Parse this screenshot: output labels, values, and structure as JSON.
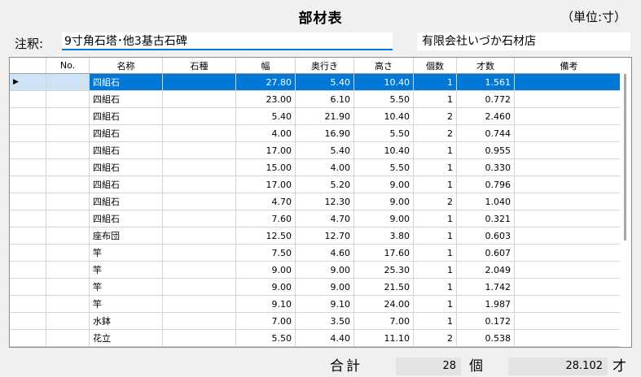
{
  "title": "部材表",
  "unit": "（単位:寸）",
  "note": {
    "label": "注釈:",
    "value": "9寸角石塔･他3基古石碑"
  },
  "company": "有限会社いづか石材店",
  "grid": {
    "columns": [
      "No.",
      "名称",
      "石種",
      "幅",
      "奥行き",
      "高さ",
      "個数",
      "才数",
      "備考"
    ],
    "selected_row": 0,
    "rows": [
      {
        "no": "",
        "name": "四組石",
        "stone": "",
        "width": "27.80",
        "depth": "5.40",
        "height": "10.40",
        "count": "1",
        "sai": "1.561",
        "note": ""
      },
      {
        "no": "",
        "name": "四組石",
        "stone": "",
        "width": "23.00",
        "depth": "6.10",
        "height": "5.50",
        "count": "1",
        "sai": "0.772",
        "note": ""
      },
      {
        "no": "",
        "name": "四組石",
        "stone": "",
        "width": "5.40",
        "depth": "21.90",
        "height": "10.40",
        "count": "2",
        "sai": "2.460",
        "note": ""
      },
      {
        "no": "",
        "name": "四組石",
        "stone": "",
        "width": "4.00",
        "depth": "16.90",
        "height": "5.50",
        "count": "2",
        "sai": "0.744",
        "note": ""
      },
      {
        "no": "",
        "name": "四組石",
        "stone": "",
        "width": "17.00",
        "depth": "5.40",
        "height": "10.40",
        "count": "1",
        "sai": "0.955",
        "note": ""
      },
      {
        "no": "",
        "name": "四組石",
        "stone": "",
        "width": "15.00",
        "depth": "4.00",
        "height": "5.50",
        "count": "1",
        "sai": "0.330",
        "note": ""
      },
      {
        "no": "",
        "name": "四組石",
        "stone": "",
        "width": "17.00",
        "depth": "5.20",
        "height": "9.00",
        "count": "1",
        "sai": "0.796",
        "note": ""
      },
      {
        "no": "",
        "name": "四組石",
        "stone": "",
        "width": "4.70",
        "depth": "12.30",
        "height": "9.00",
        "count": "2",
        "sai": "1.040",
        "note": ""
      },
      {
        "no": "",
        "name": "四組石",
        "stone": "",
        "width": "7.60",
        "depth": "4.70",
        "height": "9.00",
        "count": "1",
        "sai": "0.321",
        "note": ""
      },
      {
        "no": "",
        "name": "座布団",
        "stone": "",
        "width": "12.50",
        "depth": "12.70",
        "height": "3.80",
        "count": "1",
        "sai": "0.603",
        "note": ""
      },
      {
        "no": "",
        "name": "竿",
        "stone": "",
        "width": "7.50",
        "depth": "4.60",
        "height": "17.60",
        "count": "1",
        "sai": "0.607",
        "note": ""
      },
      {
        "no": "",
        "name": "竿",
        "stone": "",
        "width": "9.00",
        "depth": "9.00",
        "height": "25.30",
        "count": "1",
        "sai": "2.049",
        "note": ""
      },
      {
        "no": "",
        "name": "竿",
        "stone": "",
        "width": "9.00",
        "depth": "9.00",
        "height": "21.50",
        "count": "1",
        "sai": "1.742",
        "note": ""
      },
      {
        "no": "",
        "name": "竿",
        "stone": "",
        "width": "9.10",
        "depth": "9.10",
        "height": "24.00",
        "count": "1",
        "sai": "1.987",
        "note": ""
      },
      {
        "no": "",
        "name": "水鉢",
        "stone": "",
        "width": "7.00",
        "depth": "3.50",
        "height": "7.00",
        "count": "1",
        "sai": "0.172",
        "note": ""
      },
      {
        "no": "",
        "name": "花立",
        "stone": "",
        "width": "5.50",
        "depth": "4.40",
        "height": "11.10",
        "count": "2",
        "sai": "0.538",
        "note": ""
      }
    ]
  },
  "totals": {
    "label": "合計",
    "count": "28",
    "count_unit": "個",
    "volume": "28.102",
    "volume_unit": "才"
  },
  "colors": {
    "selection": "#0078d7",
    "focus_underline": "#0078d7"
  },
  "icons": {
    "row_indicator": "triangle-right"
  }
}
